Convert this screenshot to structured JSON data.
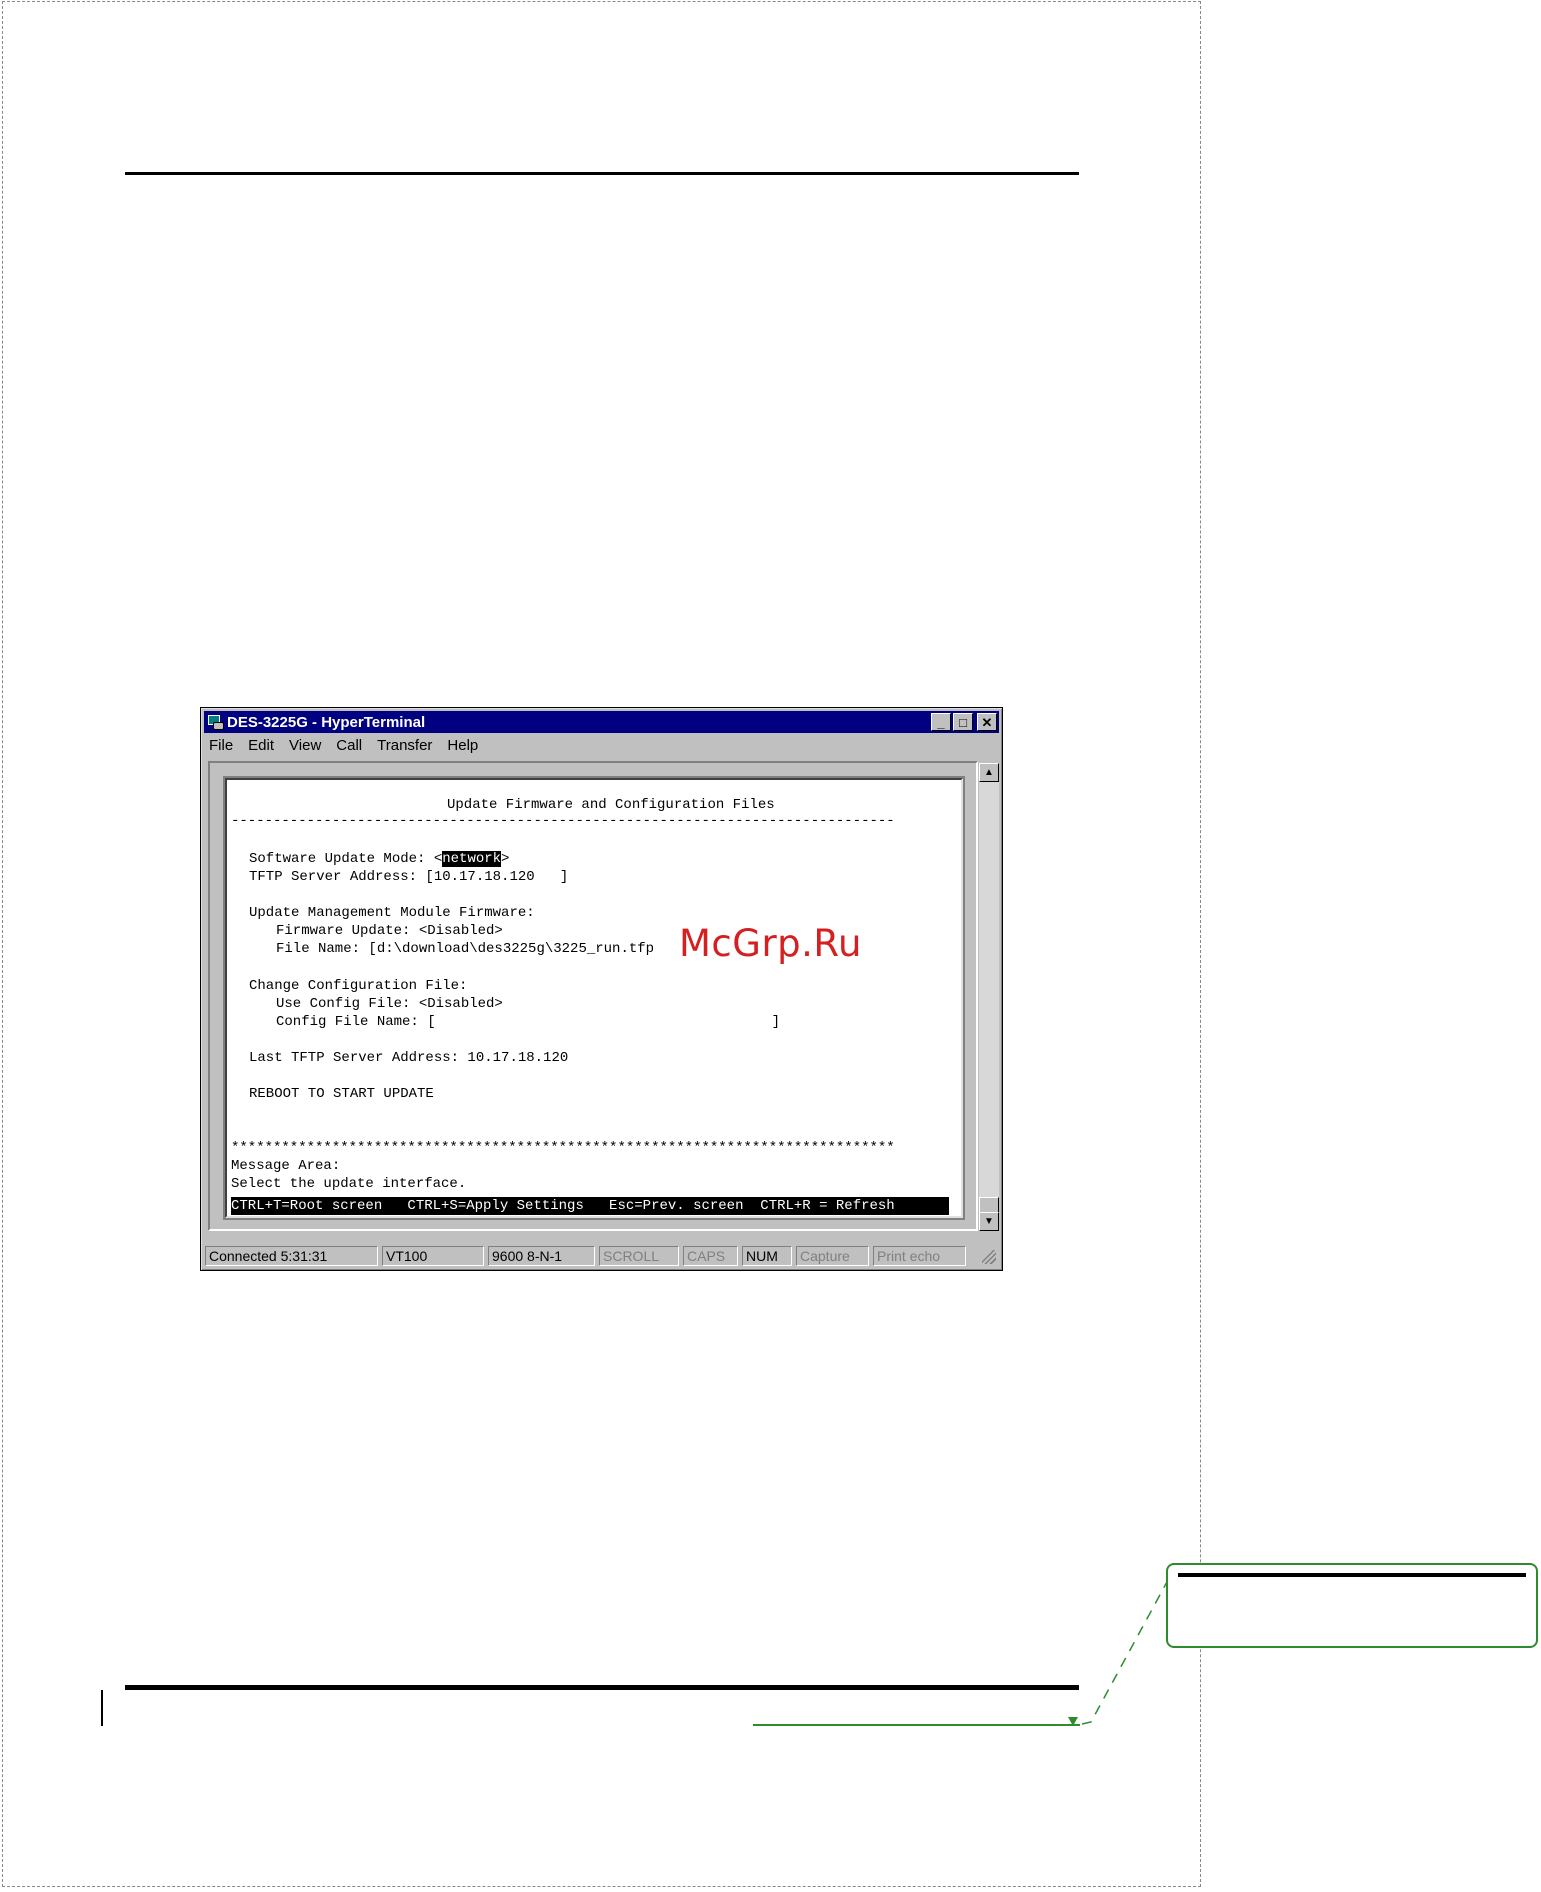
{
  "window": {
    "title": "DES-3225G - HyperTerminal",
    "buttons": {
      "minimize": "_",
      "maximize": "□",
      "close": "✕"
    }
  },
  "menu": [
    "File",
    "Edit",
    "View",
    "Call",
    "Transfer",
    "Help"
  ],
  "terminal": {
    "heading": "Update Firmware and Configuration Files",
    "separator": "-------------------------------------------------------------------------------",
    "update_mode_label": "Software Update Mode: <",
    "update_mode_value": "network",
    "update_mode_close": ">",
    "tftp_line": "TFTP Server Address: [10.17.18.120   ]",
    "mgmt_heading": "Update Management Module Firmware:",
    "fw_update_line": "Firmware Update: <Disabled>",
    "fw_file_line": "File Name: [d:\\download\\des3225g\\3225_run.tfp",
    "config_heading": "Change Configuration File:",
    "use_config_line": "Use Config File: <Disabled>",
    "config_name_line": "Config File Name: [                                        ]",
    "last_tftp_line": "Last TFTP Server Address: 10.17.18.120",
    "reboot_line": "REBOOT TO START UPDATE",
    "stars": "*******************************************************************************",
    "message_label": "Message Area:",
    "message_text": "Select the update interface.",
    "hotkeys": "CTRL+T=Root screen   CTRL+S=Apply Settings   Esc=Prev. screen  CTRL+R = Refresh"
  },
  "statusbar": {
    "connected": "Connected 5:31:31",
    "emulation": "VT100",
    "port": "9600 8-N-1",
    "scroll": "SCROLL",
    "caps": "CAPS",
    "num": "NUM",
    "capture": "Capture",
    "print_echo": "Print echo"
  },
  "watermark": "McGrp.Ru",
  "colors": {
    "titlebar": "#000080",
    "window_face": "#c0c0c0",
    "callout_green": "#2e8b2e",
    "watermark_red": "#d42020"
  }
}
